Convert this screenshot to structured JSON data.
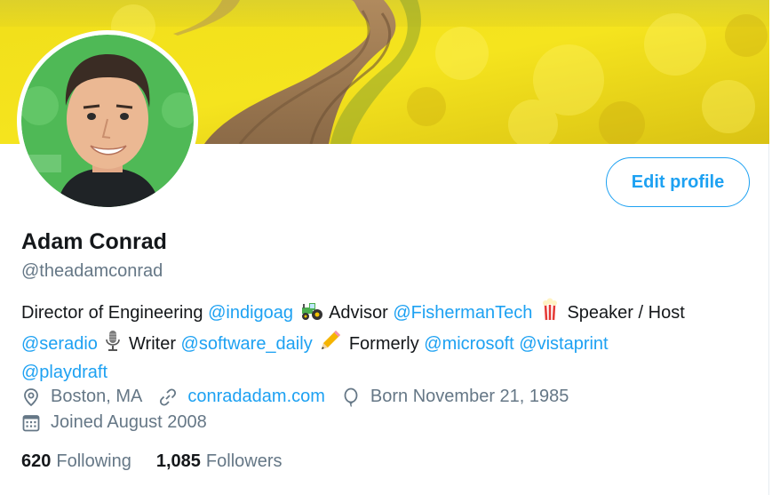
{
  "profile": {
    "name": "Adam Conrad",
    "handle": "@theadamconrad",
    "edit_label": "Edit profile",
    "bio": {
      "t1": "Director of Engineering ",
      "m1": "@indigoag",
      "t2": " Advisor ",
      "m2": "@FishermanTech",
      "t3": " Speaker / Host ",
      "m3": "@seradio",
      "t4": " Writer ",
      "m4": "@software_daily",
      "t5": " Formerly ",
      "m5": "@microsoft",
      "t6": " ",
      "m6": "@vistaprint",
      "m7": "@playdraft"
    },
    "location": "Boston, MA",
    "website": "conradadam.com",
    "birthday": "Born November 21, 1985",
    "joined": "Joined August 2008",
    "following_count": "620",
    "following_label": "Following",
    "followers_count": "1,085",
    "followers_label": "Followers"
  },
  "colors": {
    "accent": "#1da1f2",
    "secondary_text": "#657786",
    "primary_text": "#14171a"
  },
  "icons": [
    "location-pin-icon",
    "link-icon",
    "balloon-icon",
    "calendar-icon",
    "tractor-emoji",
    "popcorn-emoji",
    "microphone-emoji",
    "pencil-emoji"
  ]
}
